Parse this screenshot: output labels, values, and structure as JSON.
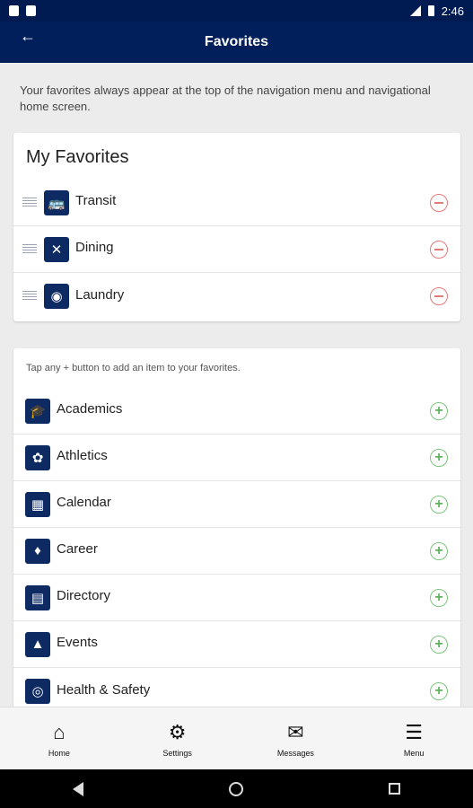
{
  "status": {
    "time": "2:46"
  },
  "appbar": {
    "title": "Favorites",
    "back_icon": "arrow-left-icon"
  },
  "intro": "Your favorites always appear at the top of the navigation menu and navigational home screen.",
  "favorites": {
    "title": "My Favorites",
    "items": [
      {
        "label": "Transit",
        "icon": "bus-icon"
      },
      {
        "label": "Dining",
        "icon": "utensils-icon"
      },
      {
        "label": "Laundry",
        "icon": "washer-icon"
      }
    ]
  },
  "available": {
    "hint": "Tap any + button to add an item to your favorites.",
    "items": [
      {
        "label": "Academics",
        "icon": "graduation-cap-icon"
      },
      {
        "label": "Athletics",
        "icon": "paw-icon"
      },
      {
        "label": "Calendar",
        "icon": "calendar-icon"
      },
      {
        "label": "Career",
        "icon": "handshake-icon"
      },
      {
        "label": "Directory",
        "icon": "id-card-icon"
      },
      {
        "label": "Events",
        "icon": "tent-icon"
      },
      {
        "label": "Health & Safety",
        "icon": "life-ring-icon"
      }
    ]
  },
  "bottomnav": [
    {
      "label": "Home",
      "icon": "home-icon"
    },
    {
      "label": "Settings",
      "icon": "gear-icon"
    },
    {
      "label": "Messages",
      "icon": "megaphone-icon"
    },
    {
      "label": "Menu",
      "icon": "hamburger-icon"
    }
  ],
  "colors": {
    "primary": "#001f5b",
    "remove": "#e37b7b",
    "add": "#7cc57c"
  }
}
